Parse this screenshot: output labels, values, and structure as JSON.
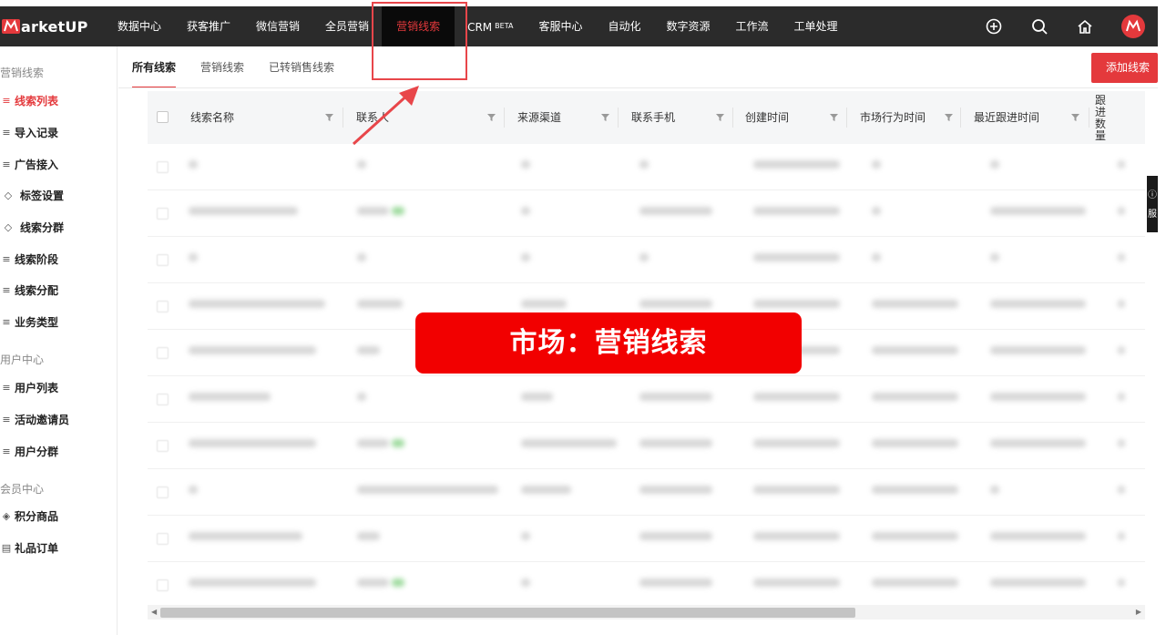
{
  "topnav": {
    "logo_text": "arketUP",
    "items": [
      {
        "label": "数据中心"
      },
      {
        "label": "获客推广"
      },
      {
        "label": "微信营销"
      },
      {
        "label": "全员营销"
      },
      {
        "label": "营销线索",
        "active": true
      },
      {
        "label": "CRM",
        "badge": "BETA"
      },
      {
        "label": "客服中心"
      },
      {
        "label": "自动化"
      },
      {
        "label": "数字资源"
      },
      {
        "label": "工作流"
      },
      {
        "label": "工单处理"
      }
    ],
    "right_icons": [
      "add-circle-icon",
      "search-icon",
      "home-icon",
      "avatar-logo-icon"
    ]
  },
  "sidebar": {
    "groups": [
      {
        "title": "营销线索",
        "items": [
          {
            "label": "线索列表",
            "icon": "search-list-icon",
            "active": true
          },
          {
            "label": "导入记录",
            "icon": "search-list-icon"
          },
          {
            "label": "广告接入",
            "icon": "search-list-icon"
          },
          {
            "label": "标签设置",
            "icon": "tag-icon"
          },
          {
            "label": "线索分群",
            "icon": "tag-icon"
          },
          {
            "label": "线索阶段",
            "icon": "search-list-icon"
          },
          {
            "label": "线索分配",
            "icon": "search-list-icon"
          },
          {
            "label": "业务类型",
            "icon": "search-list-icon"
          }
        ]
      },
      {
        "title": "用户中心",
        "items": [
          {
            "label": "用户列表",
            "icon": "search-list-icon"
          },
          {
            "label": "活动邀请员",
            "icon": "search-list-icon"
          },
          {
            "label": "用户分群",
            "icon": "search-list-icon"
          }
        ]
      },
      {
        "title": "会员中心",
        "items": [
          {
            "label": "积分商品",
            "icon": "gift-icon"
          },
          {
            "label": "礼品订单",
            "icon": "order-icon"
          }
        ]
      }
    ]
  },
  "tabs": [
    {
      "label": "所有线索",
      "active": true
    },
    {
      "label": "营销线索"
    },
    {
      "label": "已转销售线索"
    }
  ],
  "add_button": "添加线索",
  "table": {
    "columns": [
      "线索名称",
      "联系人",
      "来源渠道",
      "联系手机",
      "创建时间",
      "市场行为时间",
      "最近跟进时间"
    ],
    "vertical_column": "跟进数量"
  },
  "side_float_label": "服",
  "overlay_text": "市场：营销线索",
  "colors": {
    "accent": "#e4393c",
    "nav_bg": "#2b2b2b",
    "overlay_bg": "#f20000"
  }
}
